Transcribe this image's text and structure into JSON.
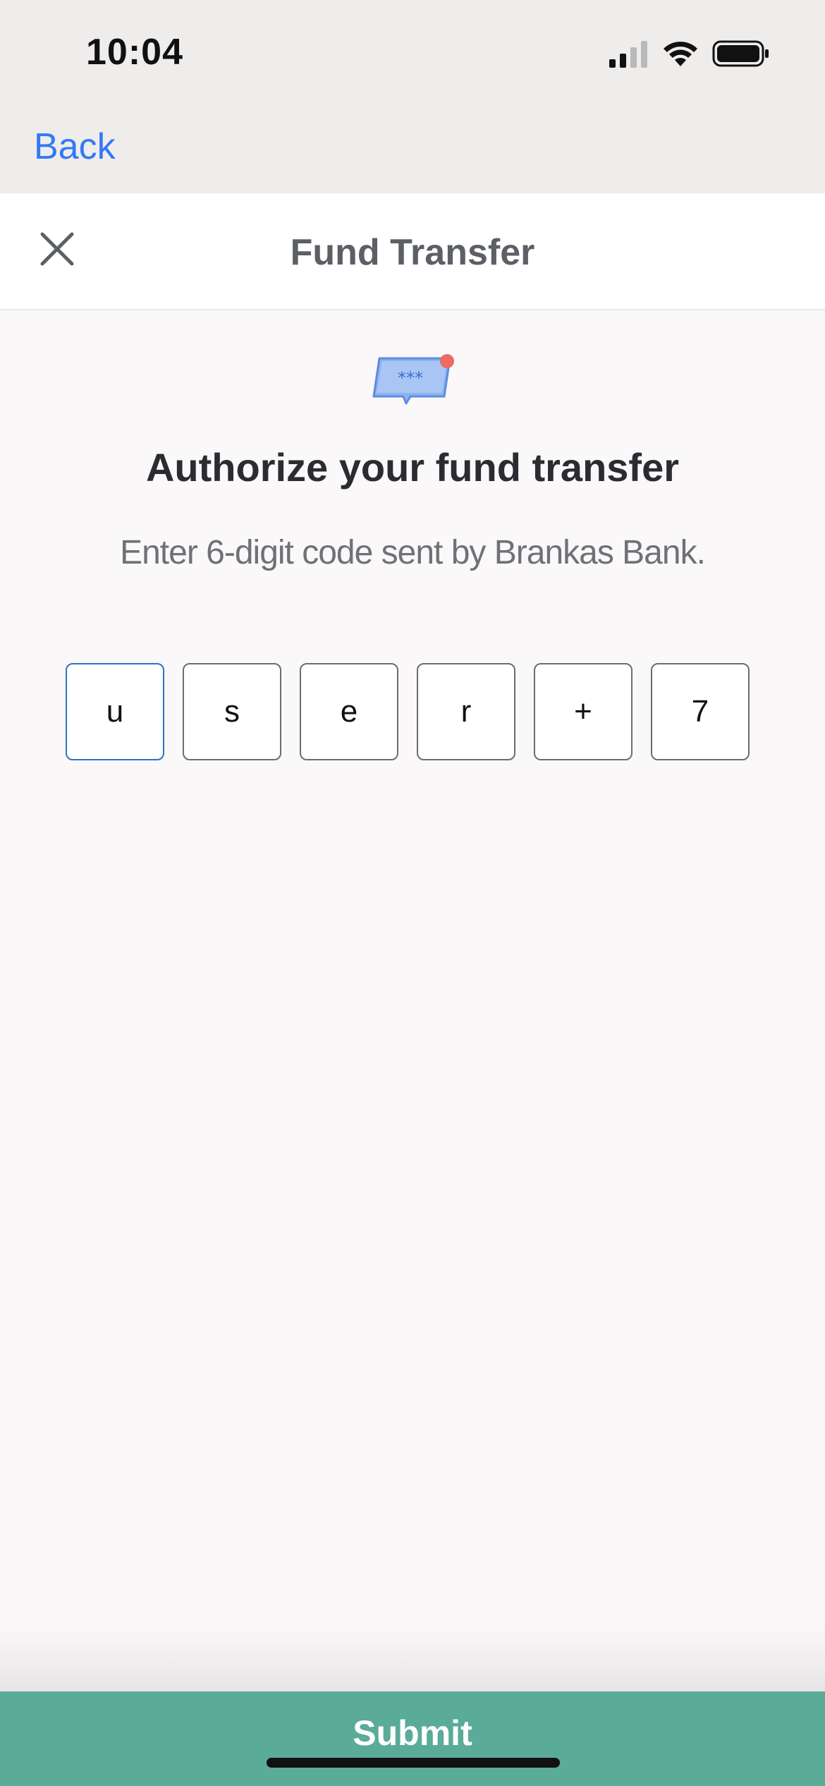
{
  "status_bar": {
    "time": "10:04",
    "icons": [
      "cellular-signal-icon",
      "wifi-icon",
      "battery-icon"
    ]
  },
  "nav": {
    "back_label": "Back"
  },
  "header": {
    "title": "Fund Transfer",
    "close_icon": "close-icon"
  },
  "main": {
    "illustration_icon": "message-code-icon",
    "illustration_text": "***",
    "title": "Authorize your fund transfer",
    "subtitle": "Enter 6-digit code sent by Brankas Bank.",
    "code_digits": [
      "u",
      "s",
      "e",
      "r",
      "+",
      "7"
    ]
  },
  "footer": {
    "submit_label": "Submit"
  },
  "colors": {
    "accent": "#3478f6",
    "submit_bg": "#5aab98",
    "active_border": "#2b73c6",
    "notification_dot": "#ee6a66"
  }
}
